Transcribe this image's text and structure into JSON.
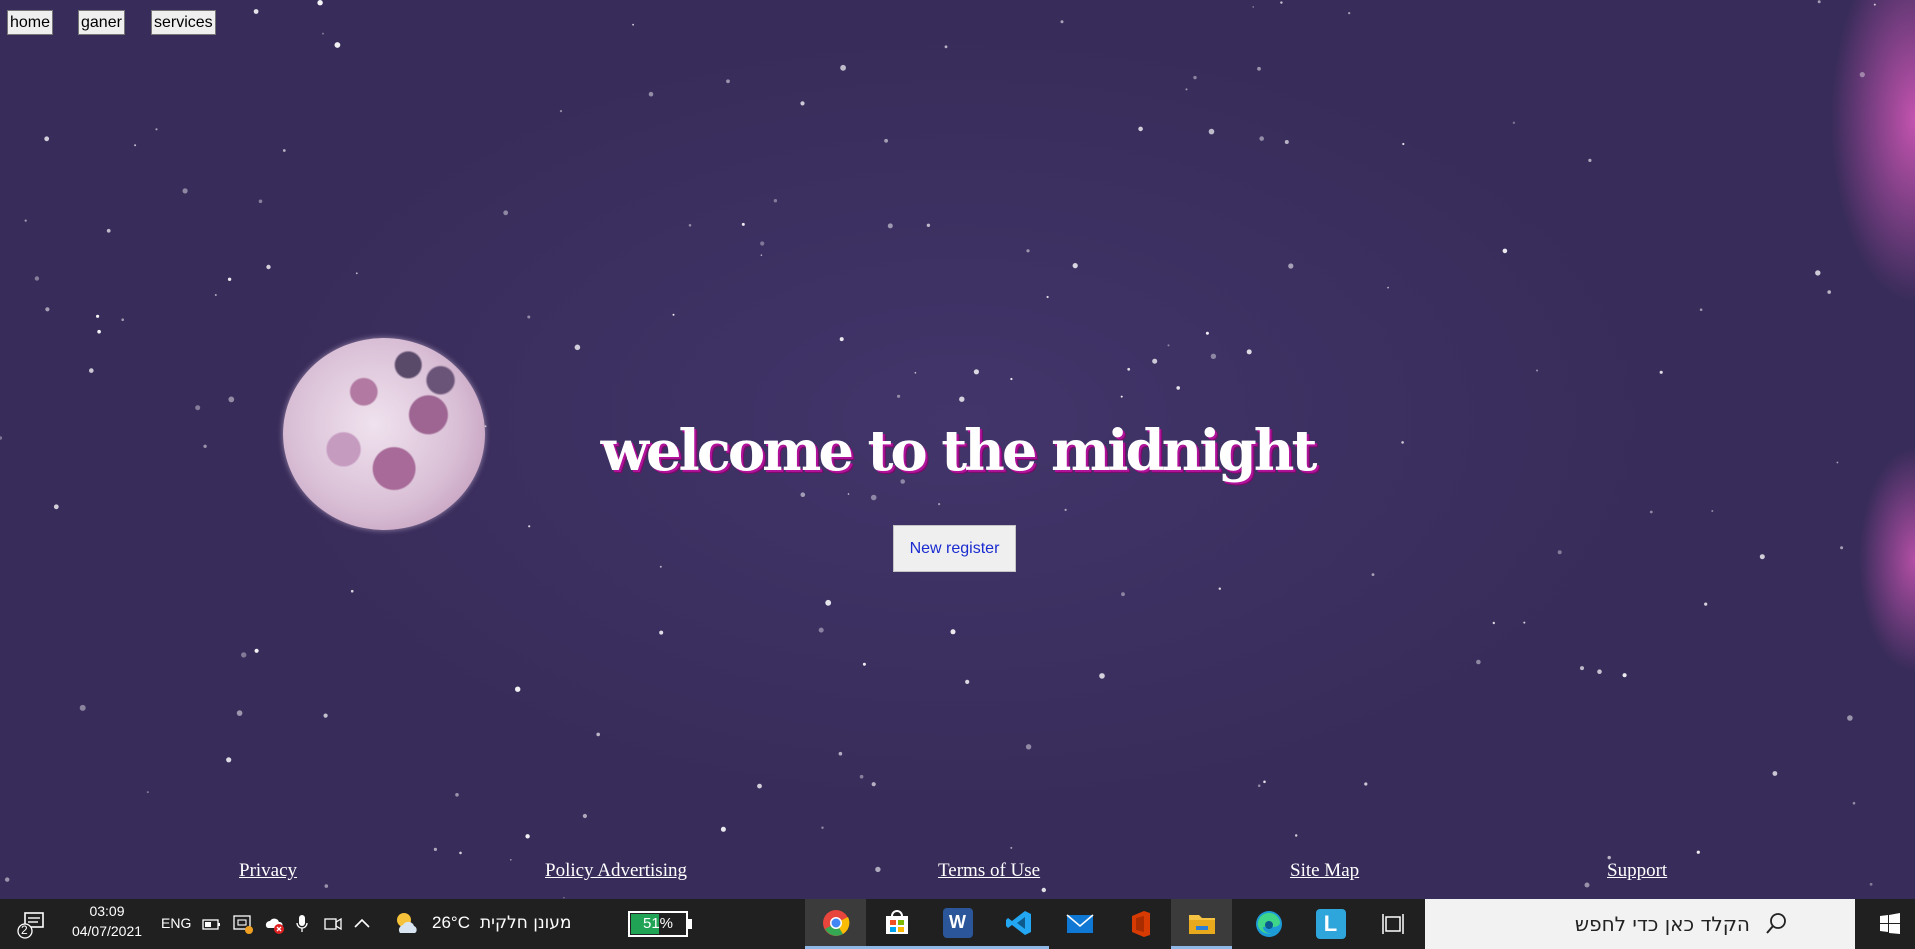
{
  "nav": {
    "items": [
      {
        "label": "home"
      },
      {
        "label": "ganer"
      },
      {
        "label": "services"
      }
    ]
  },
  "hero": {
    "headline": "welcome to the midnight",
    "register_label": "New register"
  },
  "footer": {
    "links": [
      {
        "label": "Privacy"
      },
      {
        "label": "Policy Advertising"
      },
      {
        "label": "Terms of Use"
      },
      {
        "label": "Site Map"
      },
      {
        "label": "Support"
      }
    ]
  },
  "taskbar": {
    "notification_count": "2",
    "time": "03:09",
    "date": "04/07/2021",
    "language": "ENG",
    "weather_temp": "26°C",
    "weather_desc": "מעונן חלקית",
    "battery_percent": "51%",
    "battery_level": 0.51,
    "search_placeholder": "הקלד כאן כדי לחפש",
    "apps": [
      {
        "name": "chrome",
        "state": "active"
      },
      {
        "name": "store",
        "state": "running"
      },
      {
        "name": "word",
        "state": "running"
      },
      {
        "name": "vscode",
        "state": "running"
      },
      {
        "name": "mail",
        "state": "idle"
      },
      {
        "name": "office",
        "state": "idle"
      },
      {
        "name": "file-explorer",
        "state": "active"
      },
      {
        "name": "edge",
        "state": "idle"
      },
      {
        "name": "l-app",
        "state": "idle"
      }
    ],
    "colors": {
      "chrome": "#e8453c",
      "store": "#0a64c4",
      "word": "#2b579a",
      "vscode": "#23a7f2",
      "mail": "#0f78d4",
      "office": "#d83b01",
      "explorer": "#f6c342",
      "edge": "#1d9bd7",
      "l_app": "#2ea6db"
    }
  }
}
